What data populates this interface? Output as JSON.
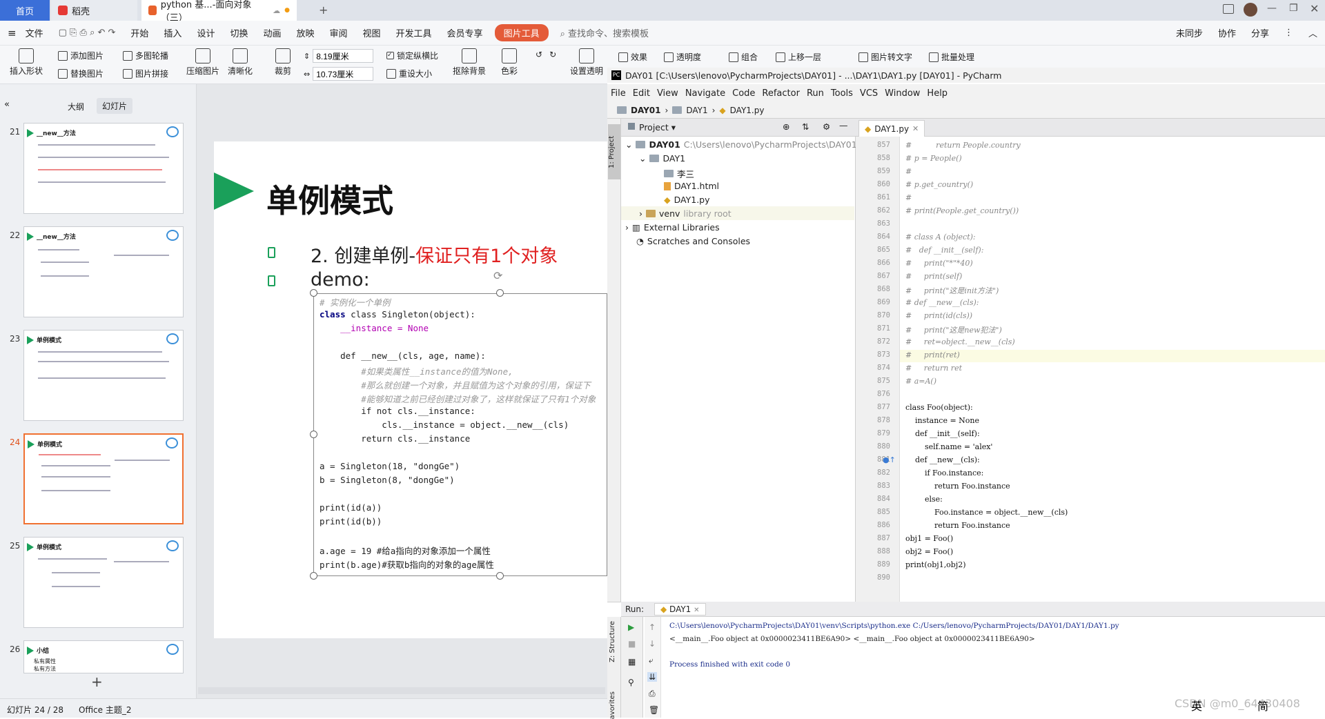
{
  "wps": {
    "tabs": {
      "home": "首页",
      "daoke": "稻壳",
      "doc": "python 基...-面向对象（三）"
    },
    "menu": [
      "文件",
      "开始",
      "插入",
      "设计",
      "切换",
      "动画",
      "放映",
      "审阅",
      "视图",
      "开发工具",
      "会员专享"
    ],
    "picture_tool": "图片工具",
    "search": "查找命令、搜索模板",
    "right_actions": [
      "未同步",
      "协作",
      "分享"
    ],
    "ribbon": {
      "insert_shape": "插入形状",
      "add_picture": "添加图片",
      "replace_picture": "替换图片",
      "multi_carousel": "多图轮播",
      "picture_splice": "图片拼接",
      "compress": "压缩图片",
      "sharpen": "清晰化",
      "crop": "裁剪",
      "height": "8.19厘米",
      "width": "10.73厘米",
      "lock_ratio": "锁定纵横比",
      "reset_size": "重设大小",
      "remove_bg": "抠除背景",
      "color": "色彩",
      "set_transparent": "设置透明",
      "effects": "效果",
      "transparency": "透明度",
      "group": "组合",
      "bring_forward": "上移一层",
      "pic_to_text": "图片转文字",
      "batch": "批量处理"
    },
    "panel_tabs": {
      "outline": "大纲",
      "slides": "幻灯片"
    },
    "thumbnails": [
      {
        "num": "21",
        "title": "__new__方法"
      },
      {
        "num": "22",
        "title": "__new__方法"
      },
      {
        "num": "23",
        "title": "单例模式"
      },
      {
        "num": "24",
        "title": "单例模式"
      },
      {
        "num": "25",
        "title": "单例模式"
      },
      {
        "num": "26",
        "title": "小结",
        "lines": [
          "私有属性",
          "私有方法"
        ]
      }
    ],
    "slide": {
      "title": "单例模式",
      "bullet1_prefix": "2. 创建单例-",
      "bullet1_red": "保证只有1个对象",
      "bullet2": "demo:",
      "code": [
        "# 实例化一个单例",
        "class Singleton(object):",
        "    __instance = None",
        "",
        "    def __new__(cls, age, name):",
        "        #如果类属性__instance的值为None,",
        "        #那么就创建一个对象，并且赋值为这个对象的引用，保证下",
        "        #能够知道之前已经创建过对象了，这样就保证了只有1个对象",
        "        if not cls.__instance:",
        "            cls.__instance = object.__new__(cls)",
        "        return cls.__instance",
        "",
        "a = Singleton(18, \"dongGe\")",
        "b = Singleton(8, \"dongGe\")",
        "",
        "print(id(a))",
        "print(id(b))",
        "",
        "a.age = 19 #给a指向的对象添加一个属性",
        "print(b.age)#获取b指向的对象的age属性"
      ]
    },
    "status": {
      "slide_pos": "幻灯片 24 / 28",
      "theme": "Office 主题_2"
    }
  },
  "pycharm": {
    "title": "DAY01 [C:\\Users\\lenovo\\PycharmProjects\\DAY01] - ...\\DAY1\\DAY1.py [DAY01] - PyCharm",
    "menu": [
      "File",
      "Edit",
      "View",
      "Navigate",
      "Code",
      "Refactor",
      "Run",
      "Tools",
      "VCS",
      "Window",
      "Help"
    ],
    "breadcrumb": [
      "DAY01",
      "DAY1",
      "DAY1.py"
    ],
    "project_label": "Project",
    "side_label": "1: Project",
    "side_label2": "Z: Structure",
    "side_label3": "avorites",
    "tree": {
      "root": "DAY01",
      "root_path": "C:\\Users\\lenovo\\PycharmProjects\\DAY01",
      "day1": "DAY1",
      "lisan": "李三",
      "html": "DAY1.html",
      "py": "DAY1.py",
      "venv": "venv",
      "venv_note": "library root",
      "ext": "External Libraries",
      "scratch": "Scratches and Consoles"
    },
    "editor_tab": "DAY1.py",
    "line_numbers": [
      "857",
      "858",
      "859",
      "860",
      "861",
      "862",
      "863",
      "864",
      "865",
      "866",
      "867",
      "868",
      "869",
      "870",
      "871",
      "872",
      "873",
      "874",
      "875",
      "876",
      "877",
      "878",
      "879",
      "880",
      "881",
      "882",
      "883",
      "884",
      "885",
      "886",
      "887",
      "888",
      "889",
      "890"
    ],
    "code": [
      "#          return People.country",
      "# p = People()",
      "#",
      "# p.get_country()",
      "#",
      "# print(People.get_country())",
      "",
      "# class A (object):",
      "#   def __init__(self):",
      "#     print(\"*\"*40)",
      "#     print(self)",
      "#     print(\"这是init方法\")",
      "# def __new__(cls):",
      "#     print(id(cls))",
      "#     print(\"这是new犯法\")",
      "#     ret=object.__new__(cls)",
      "#     print(ret)",
      "#     return ret",
      "# a=A()",
      "",
      "class Foo(object):",
      "    instance = None",
      "    def __init__(self):",
      "        self.name = 'alex'",
      "    def __new__(cls):",
      "        if Foo.instance:",
      "            return Foo.instance",
      "        else:",
      "            Foo.instance = object.__new__(cls)",
      "            return Foo.instance",
      "obj1 = Foo()",
      "obj2 = Foo()",
      "print(obj1,obj2)",
      ""
    ],
    "run": {
      "label": "Run:",
      "tab": "DAY1",
      "line1": "C:\\Users\\lenovo\\PycharmProjects\\DAY01\\venv\\Scripts\\python.exe C:/Users/lenovo/PycharmProjects/DAY01/DAY1/DAY1.py",
      "line2": "<__main__.Foo object at 0x0000023411BE6A90> <__main__.Foo object at 0x0000023411BE6A90>",
      "line3": "Process finished with exit code 0"
    },
    "ime": {
      "lang": "英",
      "mode": "简"
    },
    "watermark": "CSDN @m0_64430408"
  },
  "colors": {
    "accent_green": "#1aa05a",
    "wps_blue": "#3b6fd8",
    "pic_tool": "#e45b39",
    "red_text": "#e02020"
  }
}
